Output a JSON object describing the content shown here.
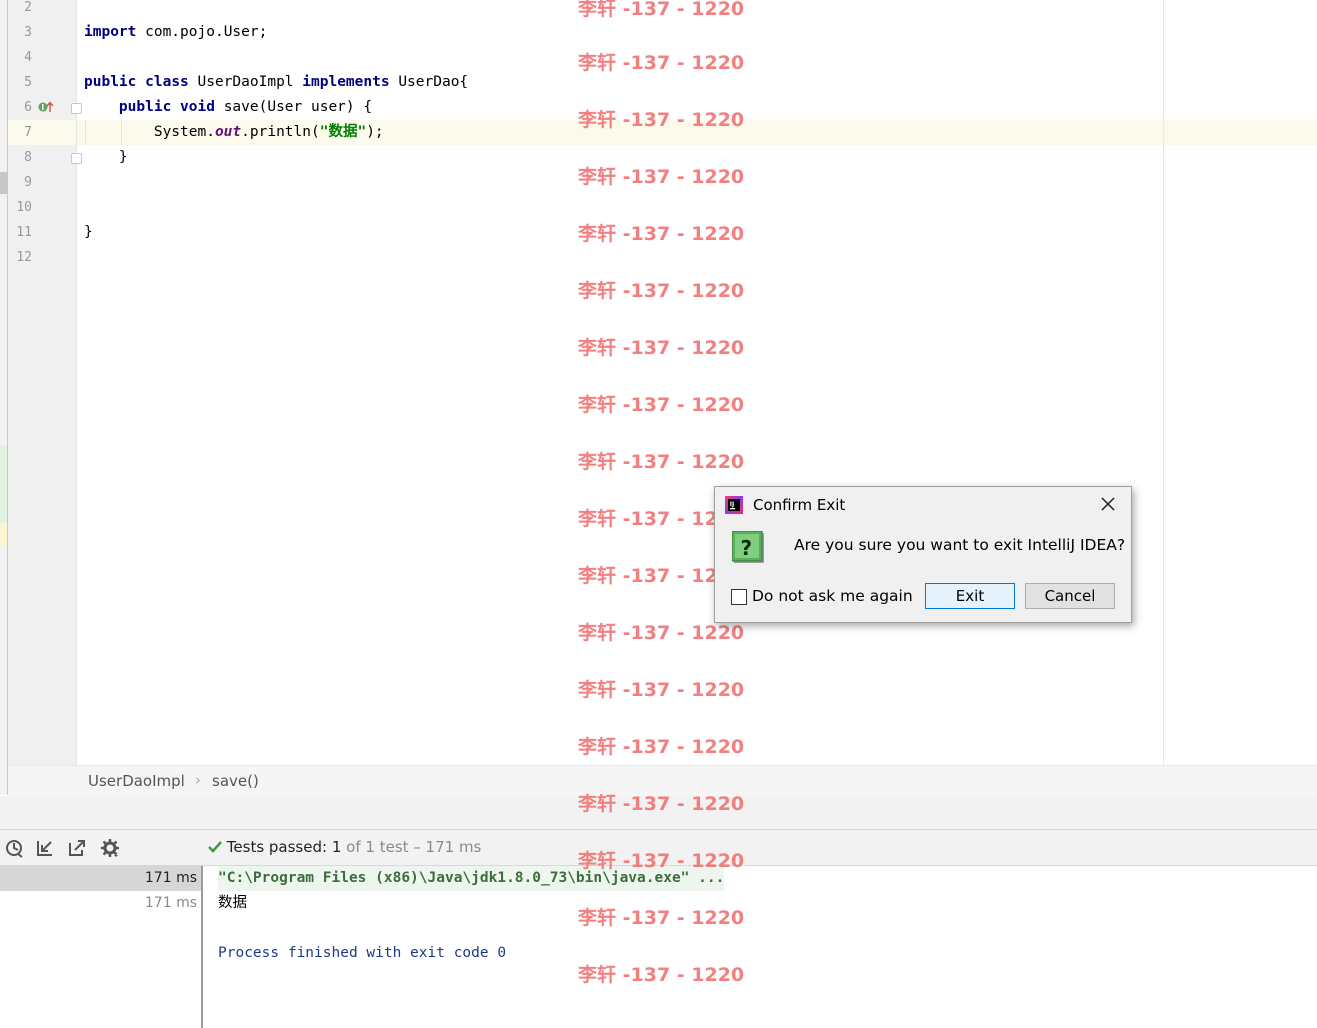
{
  "editor": {
    "line_numbers": [
      "2",
      "3",
      "4",
      "5",
      "6",
      "7",
      "8",
      "9",
      "10",
      "11",
      "12"
    ],
    "lines": [
      {
        "plain": ""
      },
      {
        "kw1": "import",
        "rest": " com.pojo.User;"
      },
      {
        "plain": ""
      },
      {
        "kw1": "public",
        "kw2": "class",
        "name": " UserDaoImpl ",
        "kw3": "implements",
        "rest": " UserDao{"
      },
      {
        "indent": "    ",
        "kw1": "public",
        "kw2": "void",
        "rest": " save(User user) {"
      },
      {
        "indent": "        ",
        "pre": "System.",
        "field": "out",
        "mid": ".println(",
        "str": "\"数据\"",
        "post": ");"
      },
      {
        "plain": "    }"
      },
      {
        "plain": ""
      },
      {
        "plain": ""
      },
      {
        "plain": "}"
      },
      {
        "plain": ""
      }
    ]
  },
  "breadcrumb": {
    "items": [
      "UserDaoImpl",
      "save()"
    ]
  },
  "run": {
    "status_label": "Tests passed:",
    "status_count": "1",
    "status_detail": "of 1 test – 171 ms",
    "tree_times": [
      "171 ms",
      "171 ms"
    ],
    "console_lines": [
      "\"C:\\Program Files (x86)\\Java\\jdk1.8.0_73\\bin\\java.exe\" ...",
      "数据",
      "",
      "Process finished with exit code 0"
    ]
  },
  "watermark": {
    "text": "李轩 -137 - 1220"
  },
  "dialog": {
    "title": "Confirm Exit",
    "message": "Are you sure you want to exit IntelliJ IDEA?",
    "checkbox_label": "Do not ask me again",
    "checkbox_checked": false,
    "exit_label": "Exit",
    "cancel_label": "Cancel"
  },
  "colors": {
    "keyword": "#000080",
    "string": "#008000",
    "field": "#660e7a",
    "watermark": "#f06b6b",
    "test_pass": "#3e9a3e"
  }
}
